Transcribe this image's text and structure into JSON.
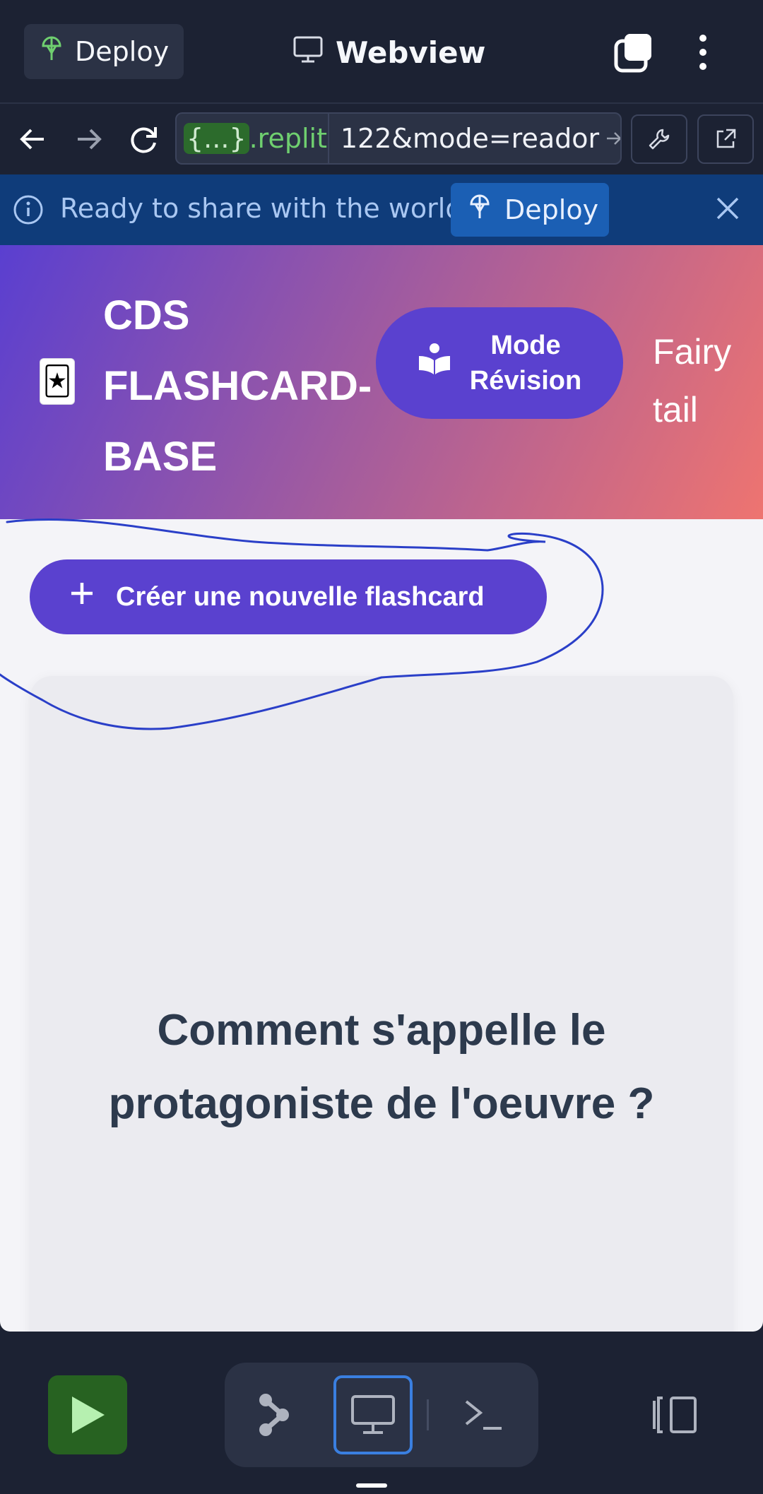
{
  "topbar": {
    "deploy_label": "Deploy",
    "title": "Webview"
  },
  "addressbar": {
    "url_badge": "{...}",
    "url_domain": ".replit.c",
    "url_path": "122&mode=reador"
  },
  "banner": {
    "message": "Ready to share with the world?",
    "deploy_label": "Deploy"
  },
  "app": {
    "logo_icon": "joker-card-icon",
    "title_lines": [
      "CDS",
      "FLASHCARD-",
      "BASE"
    ],
    "mode_button_lines": [
      "Mode",
      "Révision"
    ],
    "theme_lines": [
      "Fairy",
      "tail"
    ],
    "create_button": "Créer une nouvelle flashcard",
    "card_question_lines": [
      "Comment s'appelle le",
      "protagoniste de l'oeuvre ?"
    ]
  },
  "colors": {
    "chrome_bg": "#1c2233",
    "banner_bg": "#0f3c7a",
    "accent_purple": "#5a41cf",
    "run_green": "#276221",
    "annotation_blue": "#2a3fc8"
  },
  "icons": {
    "deploy": "deploy-icon",
    "webview": "monitor-icon",
    "tabs": "tabs-icon",
    "menu": "kebab-menu-icon",
    "back": "back-arrow-icon",
    "forward": "forward-arrow-icon",
    "reload": "reload-icon",
    "devtools": "wrench-icon",
    "open_external": "open-external-icon",
    "info": "info-icon",
    "close": "close-icon",
    "run": "play-icon",
    "git": "git-icon",
    "console": "terminal-icon",
    "split": "split-view-icon"
  }
}
